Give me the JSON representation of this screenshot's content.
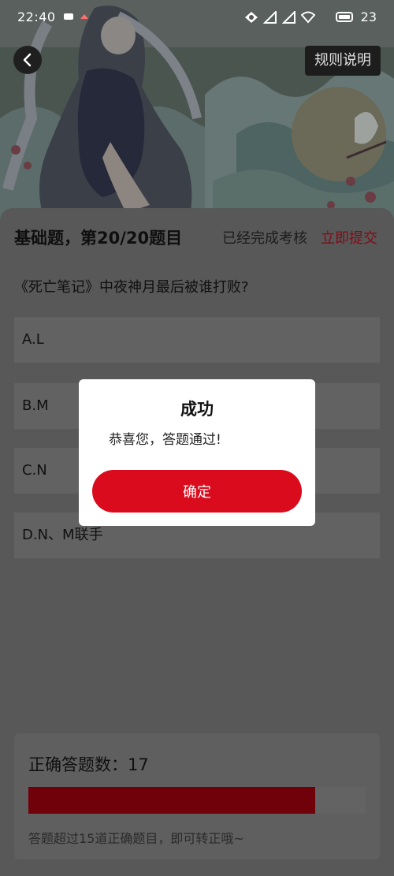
{
  "status_bar": {
    "time": "22:40",
    "battery": "23"
  },
  "header": {
    "rules_button": "规则说明"
  },
  "quiz": {
    "title": "基础题，第20/20题目",
    "completed_text": "已经完成考核",
    "submit_label": "立即提交",
    "question": "《死亡笔记》中夜神月最后被谁打败?",
    "options": [
      {
        "label": "A.L"
      },
      {
        "label": "B.M"
      },
      {
        "label": "C.N"
      },
      {
        "label": "D.N、M联手"
      }
    ]
  },
  "score": {
    "label": "正确答题数：17",
    "progress": 0.85,
    "hint": "答题超过15道正确题目，即可转正哦~"
  },
  "dialog": {
    "title": "成功",
    "message": "恭喜您，答题通过!",
    "confirm_label": "确定"
  },
  "colors": {
    "accent": "#d90b1c",
    "progress_fill": "#700009"
  }
}
